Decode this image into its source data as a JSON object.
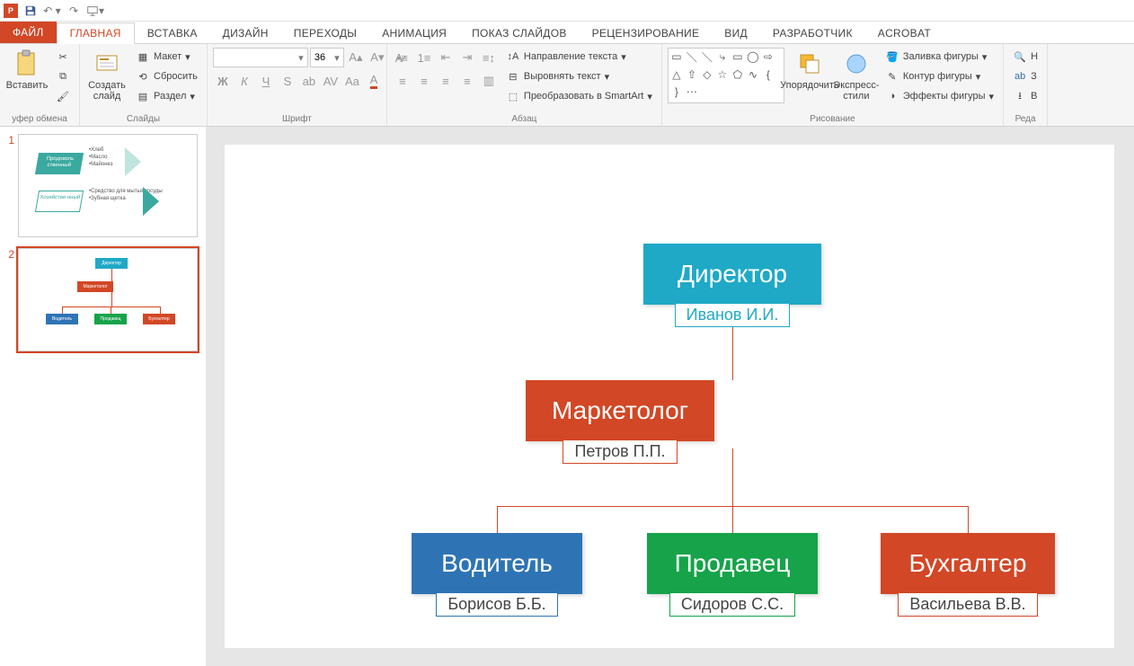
{
  "qat": {
    "save_title": "Сохранить",
    "undo_title": "Отменить",
    "redo_title": "Повторить",
    "start_title": "Начать с начала"
  },
  "tabs": {
    "file": "ФАЙЛ",
    "home": "ГЛАВНАЯ",
    "insert": "ВСТАВКА",
    "design": "ДИЗАЙН",
    "transitions": "ПЕРЕХОДЫ",
    "animation": "АНИМАЦИЯ",
    "slideshow": "ПОКАЗ СЛАЙДОВ",
    "review": "РЕЦЕНЗИРОВАНИЕ",
    "view": "ВИД",
    "developer": "РАЗРАБОТЧИК",
    "acrobat": "ACROBAT"
  },
  "ribbon": {
    "clipboard": {
      "label": "уфер обмена",
      "paste": "Вставить"
    },
    "slides": {
      "label": "Слайды",
      "new_slide": "Создать\nслайд",
      "layout": "Макет",
      "reset": "Сбросить",
      "section": "Раздел"
    },
    "font": {
      "label": "Шрифт",
      "size": "36"
    },
    "para": {
      "label": "Абзац",
      "text_direction": "Направление текста",
      "align_text": "Выровнять текст",
      "smartart": "Преобразовать в SmartArt"
    },
    "drawing": {
      "label": "Рисование",
      "arrange": "Упорядочить",
      "quick_styles": "Экспресс-\nстили",
      "fill": "Заливка фигуры",
      "outline": "Контур фигуры",
      "effects": "Эффекты фигуры"
    },
    "editing": {
      "label": "Реда",
      "find": "Н",
      "replace": "З"
    }
  },
  "thumbs": {
    "n1": "1",
    "n2": "2"
  },
  "org": {
    "director": {
      "title": "Директор",
      "name": "Иванов И.И."
    },
    "marketer": {
      "title": "Маркетолог",
      "name": "Петров П.П."
    },
    "driver": {
      "title": "Водитель",
      "name": "Борисов Б.Б."
    },
    "seller": {
      "title": "Продавец",
      "name": "Сидоров С.С."
    },
    "accountant": {
      "title": "Бухгалтер",
      "name": "Васильева В.В."
    }
  },
  "thumb1": {
    "cat1": "Продоволь\nственный",
    "i1": "Хлеб",
    "i2": "Масло",
    "i3": "Майонез",
    "cat2": "Хозяйстве\nнный",
    "i4": "Средство для\nмытья посуды",
    "i5": "Зубная щетка"
  }
}
